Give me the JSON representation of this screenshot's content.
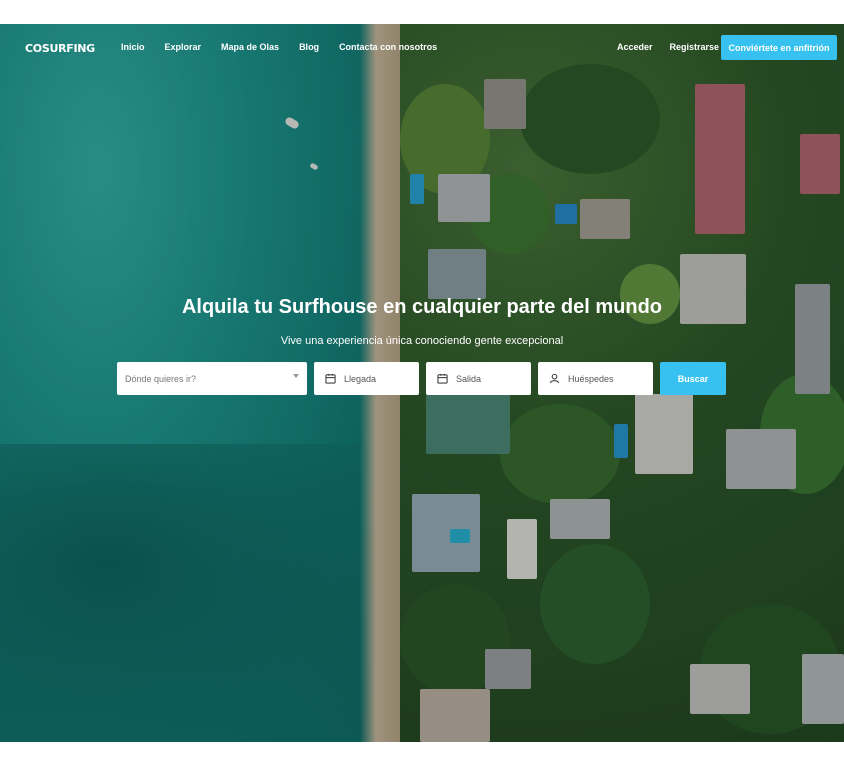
{
  "brand": {
    "logo_text": "COSURFING",
    "accent": "#36c1f0"
  },
  "nav": {
    "links": [
      "Inicio",
      "Explorar",
      "Mapa de Olas",
      "Blog",
      "Contacta con nosotros"
    ],
    "login": "Acceder",
    "register": "Registrarse",
    "host_cta": "Conviértete en anfitrión"
  },
  "hero": {
    "title": "Alquila tu Surfhouse en cualquier parte del mundo",
    "subtitle": "Vive una experiencia única conociendo gente excepcional"
  },
  "search": {
    "destination_placeholder": "Dónde quieres ir?",
    "checkin_label": "Llegada",
    "checkout_label": "Salida",
    "guests_label": "Huéspedes",
    "submit_label": "Buscar",
    "icons": {
      "checkin": "calendar-icon",
      "checkout": "calendar-icon",
      "guests": "person-icon",
      "destination": "chevron-down-icon"
    }
  }
}
